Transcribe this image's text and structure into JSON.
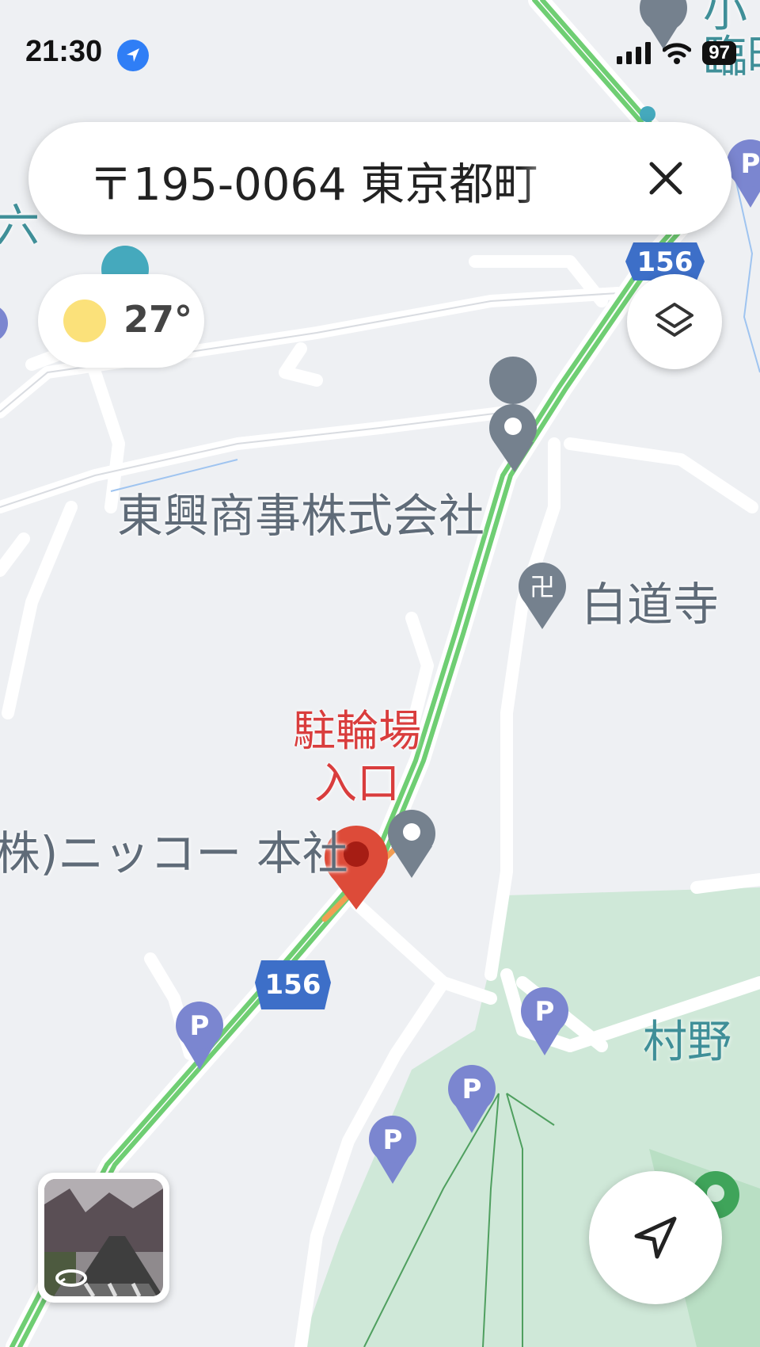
{
  "status_bar": {
    "time": "21:30",
    "battery": "97"
  },
  "search": {
    "query": "〒195-0064 東京都町"
  },
  "weather": {
    "temperature": "27°"
  },
  "map": {
    "route_number": "156",
    "places": {
      "company": "東興商事株式会社",
      "temple": "白道寺",
      "bicycle_parking_line1": "駐輪場",
      "bicycle_parking_line2": "入口",
      "nikko": "(株)ニッコー 本社",
      "murano": "村野",
      "top_right_line1": "小",
      "top_right_line2": "臨時",
      "left_edge": "六"
    },
    "parking_symbol": "P",
    "temple_symbol": "卍"
  },
  "colors": {
    "route": "#6fce73",
    "route_shield": "#3d6fc8",
    "pin_red": "#dd4b39",
    "pin_gray": "#75818e",
    "parking": "#7b86d0",
    "park_green": "#cfe8d8"
  },
  "icons": {
    "close": "close-icon",
    "layers": "layers-icon",
    "navigate": "navigation-arrow-icon",
    "street_view": "street-view-thumbnail"
  }
}
